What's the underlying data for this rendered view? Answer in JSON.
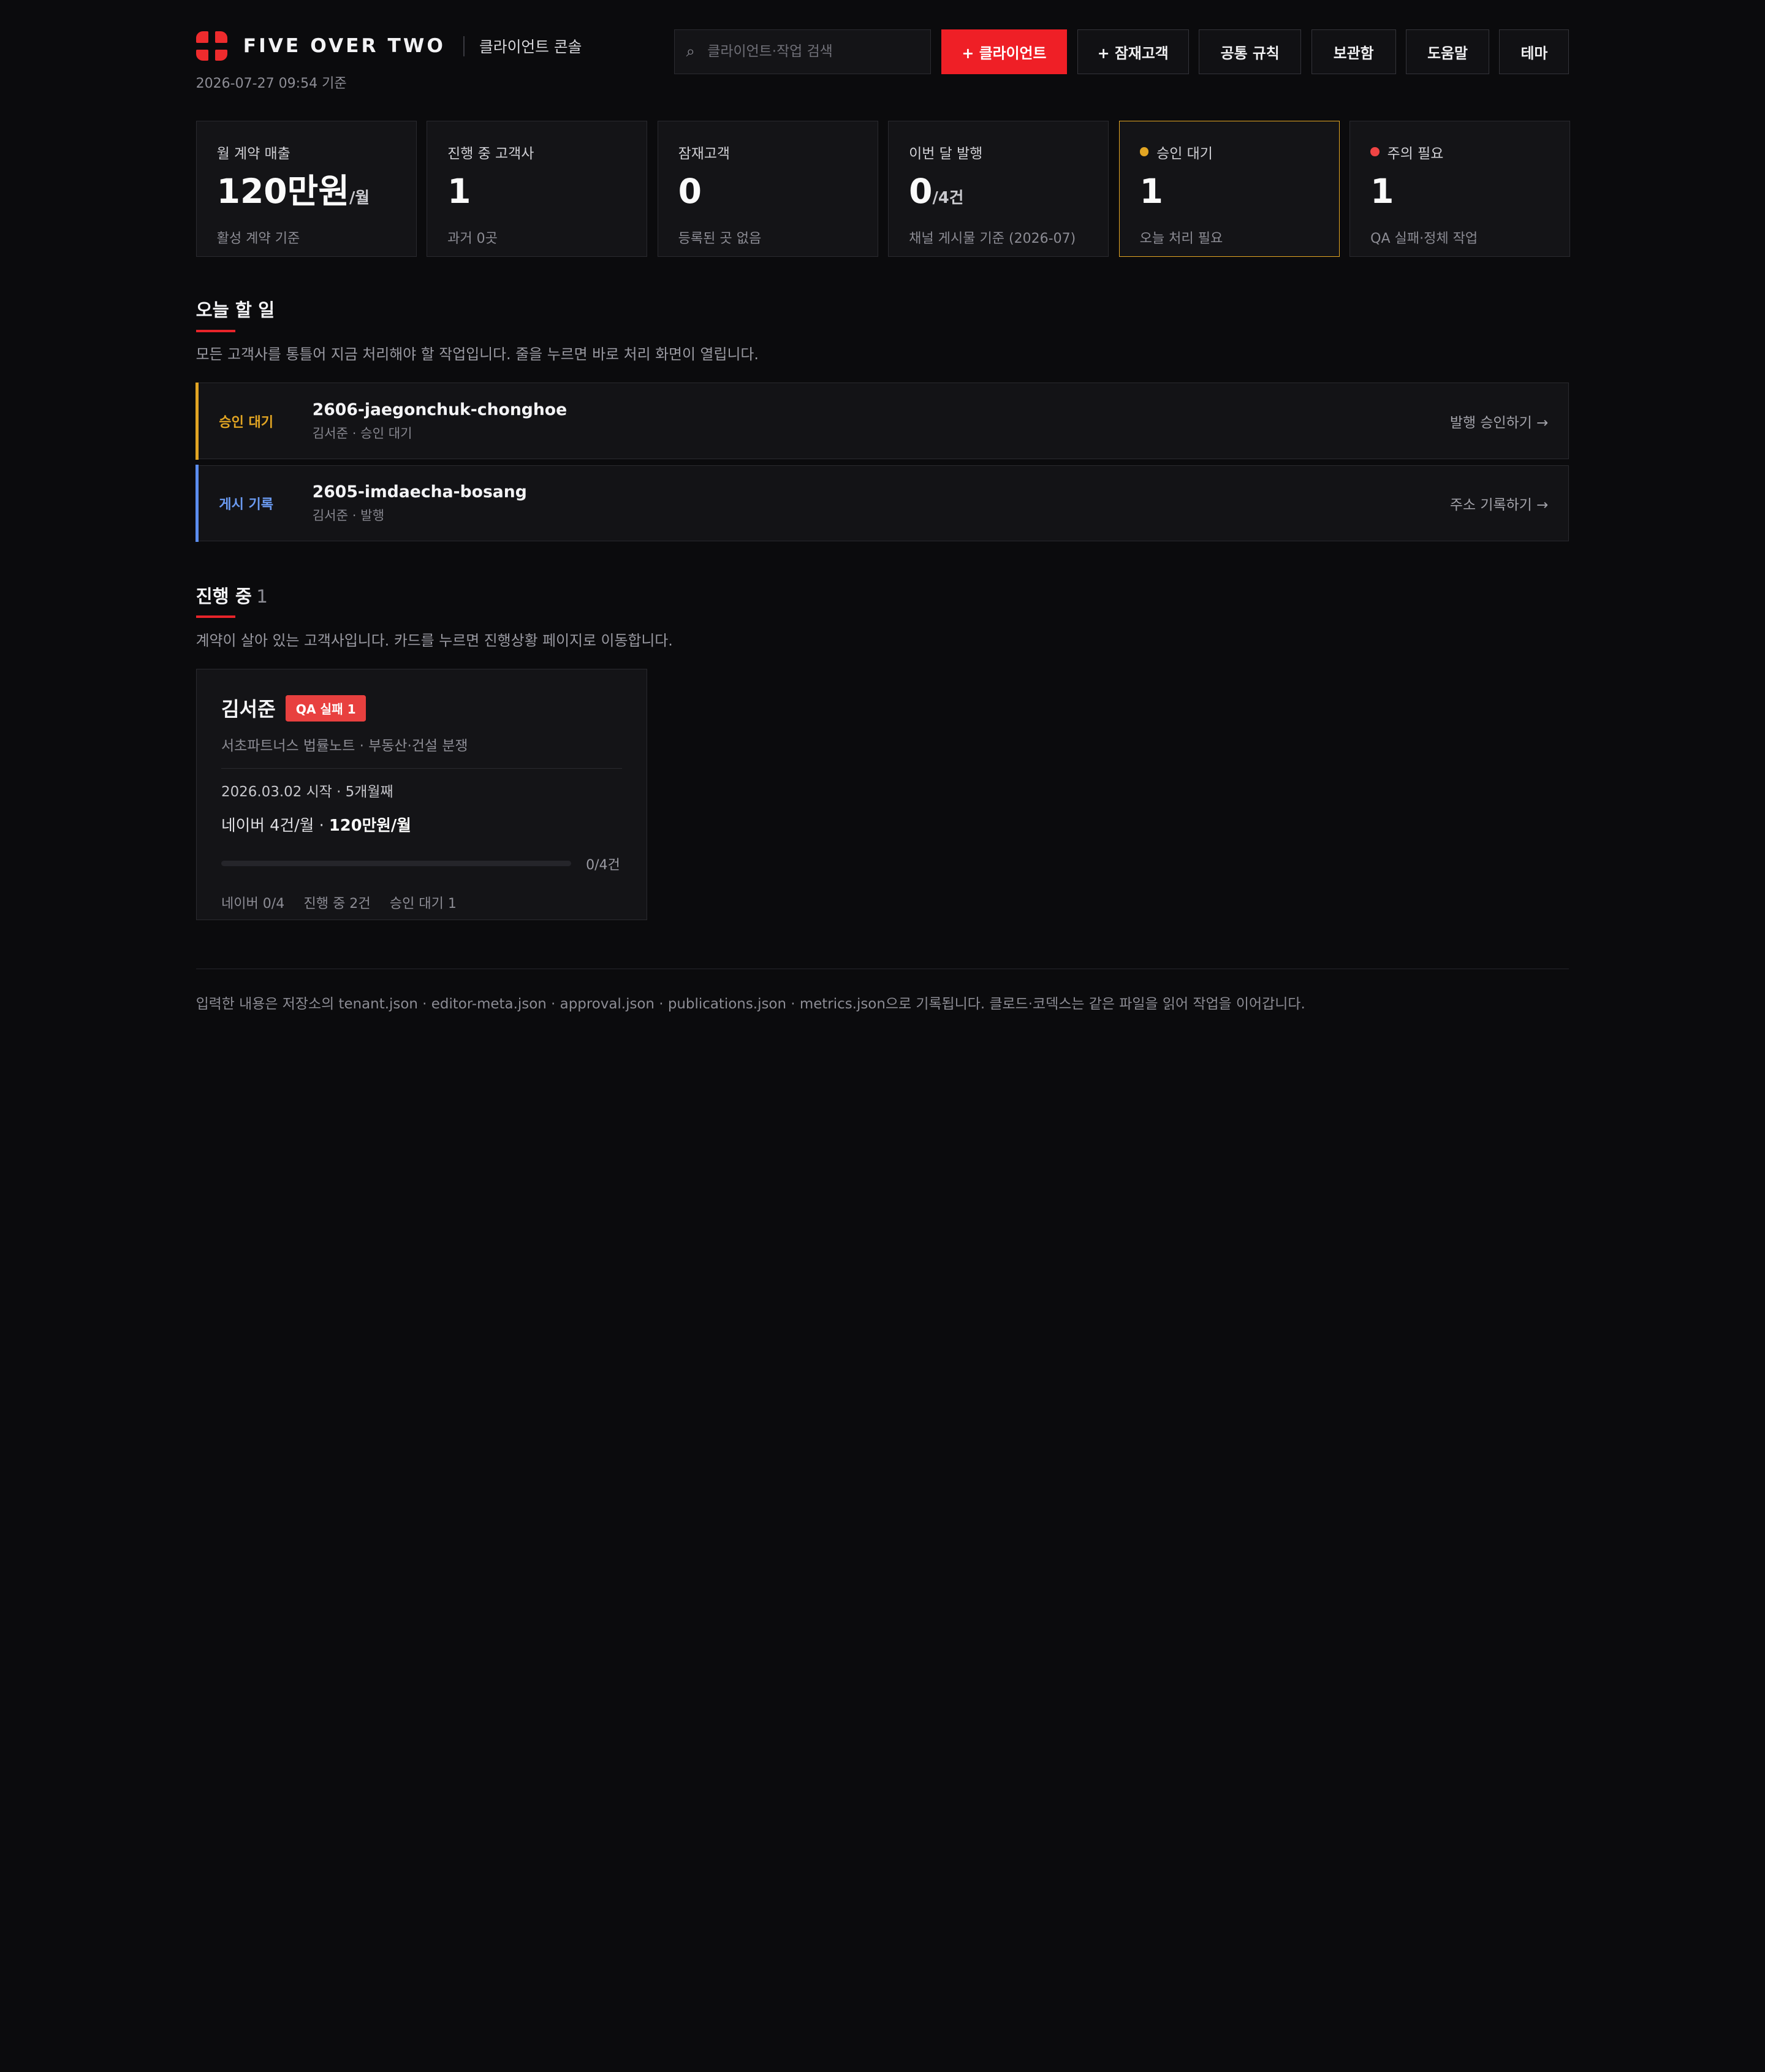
{
  "colors": {
    "accent": "#ef1f26",
    "warning": "#e2a523",
    "danger": "#ef4444",
    "info": "#5b8def",
    "background": "#0b0b0d"
  },
  "header": {
    "brand": "FIVE OVER TWO",
    "subtitle": "클라이언트 콘솔",
    "timestamp": "2026-07-27 09:54 기준",
    "search_placeholder": "클라이언트·작업 검색",
    "search_icon": "search-icon",
    "buttons": {
      "add_client": "+ 클라이언트",
      "add_prospect": "+ 잠재고객",
      "common_rules": "공통 규칙",
      "archive": "보관함",
      "help": "도움말",
      "theme": "테마"
    }
  },
  "stats": [
    {
      "label": "월 계약 매출",
      "value": "120만원",
      "unit": "/월",
      "sub": "활성 계약 기준"
    },
    {
      "label": "진행 중 고객사",
      "value": "1",
      "unit": "",
      "sub": "과거 0곳"
    },
    {
      "label": "잠재고객",
      "value": "0",
      "unit": "",
      "sub": "등록된 곳 없음"
    },
    {
      "label": "이번 달 발행",
      "value": "0",
      "unit": "/4건",
      "sub": "채널 게시물 기준 (2026-07)"
    },
    {
      "label": "승인 대기",
      "value": "1",
      "unit": "",
      "sub": "오늘 처리 필요"
    },
    {
      "label": "주의 필요",
      "value": "1",
      "unit": "",
      "sub": "QA 실패·정체 작업"
    }
  ],
  "todo": {
    "title": "오늘 할 일",
    "description": "모든 고객사를 통틀어 지금 처리해야 할 작업입니다. 줄을 누르면 바로 처리 화면이 열립니다.",
    "tasks": [
      {
        "tag": "승인 대기",
        "name": "2606-jaegonchuk-chonghoe",
        "meta": "김서준 · 승인 대기",
        "action": "발행 승인하기 →"
      },
      {
        "tag": "게시 기록",
        "name": "2605-imdaecha-bosang",
        "meta": "김서준 · 발행",
        "action": "주소 기록하기 →"
      }
    ]
  },
  "in_progress": {
    "title": "진행 중",
    "count": "1",
    "description": "계약이 살아 있는 고객사입니다. 카드를 누르면 진행상황 페이지로 이동합니다.",
    "card": {
      "name": "김서준",
      "badge": "QA 실패 1",
      "org": "서초파트너스 법률노트 · 부동산·건설 분쟁",
      "start": "2026.03.02 시작 · 5개월째",
      "plan_prefix": "네이버 4건/월 · ",
      "plan_price": "120만원/월",
      "progress_value": 0,
      "progress_total": 4,
      "progress_text": "0/4건",
      "stat_naver": "네이버 0/4",
      "stat_ongoing": "진행 중 2건",
      "stat_pending": "승인 대기 1"
    }
  },
  "footer": {
    "text": "입력한 내용은 저장소의 tenant.json · editor-meta.json · approval.json · publications.json · metrics.json으로 기록됩니다. 클로드·코덱스는 같은 파일을 읽어 작업을 이어갑니다."
  }
}
